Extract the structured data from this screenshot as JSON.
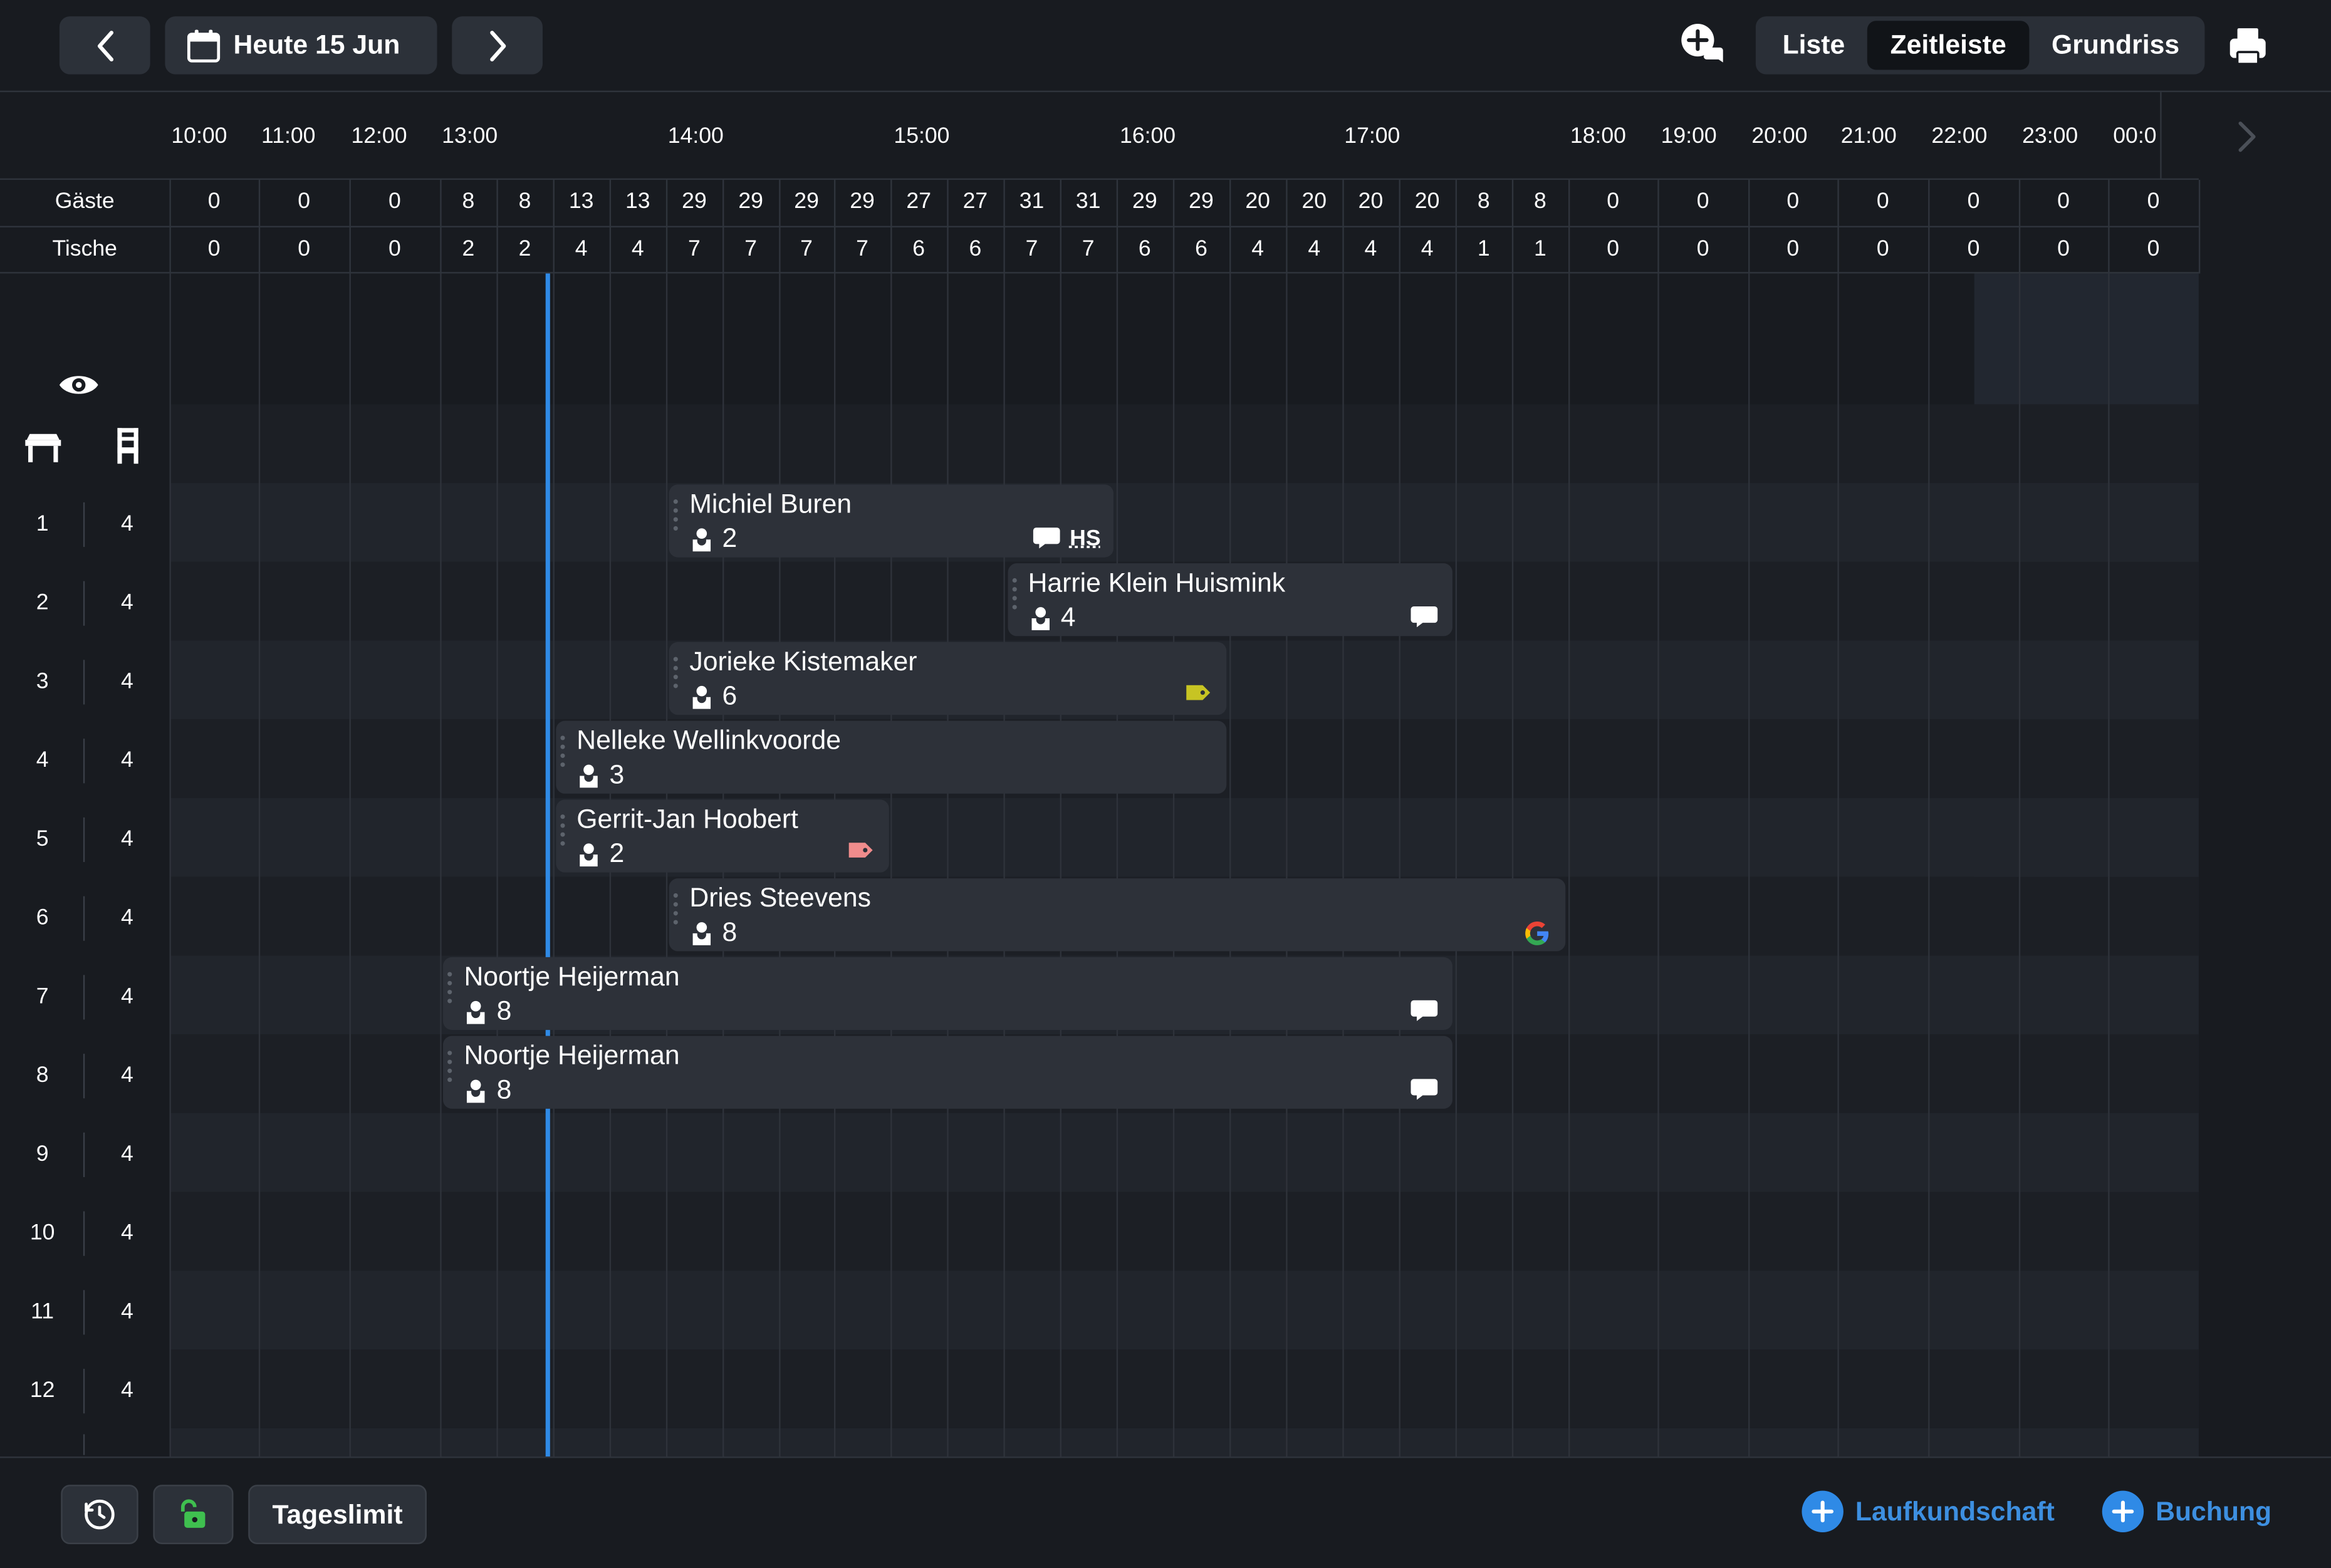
{
  "toolbar": {
    "date_label": "Heute 15 Jun",
    "views": [
      "Liste",
      "Zeitleiste",
      "Grundriss"
    ],
    "active_view": "Zeitleiste"
  },
  "timeline": {
    "hours": [
      "10:00",
      "11:00",
      "12:00",
      "13:00",
      "14:00",
      "15:00",
      "16:00",
      "17:00",
      "18:00",
      "19:00",
      "20:00",
      "21:00",
      "22:00",
      "23:00",
      "00:0"
    ],
    "row_labels": {
      "guests": "Gäste",
      "tables": "Tische"
    },
    "guest_counts": [
      "0",
      "0",
      "0",
      "8",
      "8",
      "13",
      "13",
      "29",
      "29",
      "29",
      "29",
      "27",
      "27",
      "31",
      "31",
      "29",
      "29",
      "20",
      "20",
      "20",
      "20",
      "8",
      "8",
      "0",
      "0",
      "0",
      "0",
      "0",
      "0",
      "0"
    ],
    "table_counts": [
      "0",
      "0",
      "0",
      "2",
      "2",
      "4",
      "4",
      "7",
      "7",
      "7",
      "7",
      "6",
      "6",
      "7",
      "7",
      "6",
      "6",
      "4",
      "4",
      "4",
      "4",
      "1",
      "1",
      "0",
      "0",
      "0",
      "0",
      "0",
      "0",
      "0"
    ]
  },
  "tables": [
    {
      "number": "1",
      "seats": "4"
    },
    {
      "number": "2",
      "seats": "4"
    },
    {
      "number": "3",
      "seats": "4"
    },
    {
      "number": "4",
      "seats": "4"
    },
    {
      "number": "5",
      "seats": "4"
    },
    {
      "number": "6",
      "seats": "4"
    },
    {
      "number": "7",
      "seats": "4"
    },
    {
      "number": "8",
      "seats": "4"
    },
    {
      "number": "9",
      "seats": "4"
    },
    {
      "number": "10",
      "seats": "4"
    },
    {
      "number": "11",
      "seats": "4"
    },
    {
      "number": "12",
      "seats": "4"
    }
  ],
  "bookings": [
    {
      "name": "Michiel Buren",
      "guests": "2",
      "table": "1",
      "start": "14:00",
      "end": "16:00",
      "icons": [
        "comment-icon"
      ],
      "initials": "HS"
    },
    {
      "name": "Harrie Klein Huismink",
      "guests": "4",
      "table": "2",
      "start": "15:30",
      "end": "17:30",
      "icons": [
        "comment-icon"
      ]
    },
    {
      "name": "Jorieke Kistemaker",
      "guests": "6",
      "table": "3",
      "start": "14:00",
      "end": "16:30",
      "icons": [
        "tag-yellow-icon"
      ],
      "tag_color": "#c7c423"
    },
    {
      "name": "Nelleke Wellinkvoorde",
      "guests": "3",
      "table": "4",
      "start": "13:30",
      "end": "16:30",
      "icons": []
    },
    {
      "name": "Gerrit-Jan Hoobert",
      "guests": "2",
      "table": "5",
      "start": "13:30",
      "end": "15:00",
      "icons": [
        "tag-pink-icon"
      ],
      "tag_color": "#f08c8c"
    },
    {
      "name": "Dries Steevens",
      "guests": "8",
      "table": "6",
      "start": "14:00",
      "end": "18:00",
      "icons": [
        "google-icon"
      ]
    },
    {
      "name": "Noortje Heijerman",
      "guests": "8",
      "table": "7",
      "start": "13:00",
      "end": "17:30",
      "icons": [
        "comment-icon"
      ]
    },
    {
      "name": "Noortje Heijerman",
      "guests": "8",
      "table": "8",
      "start": "13:00",
      "end": "17:30",
      "icons": [
        "comment-icon"
      ]
    }
  ],
  "current_time": "13:30",
  "colors": {
    "accent": "#2f8ae6",
    "booking_bg": "#2d3139",
    "lock_green": "#3fbf4f"
  },
  "bottombar": {
    "daily_limit_label": "Tageslimit",
    "walkin_label": "Laufkundschaft",
    "booking_label": "Buchung"
  }
}
